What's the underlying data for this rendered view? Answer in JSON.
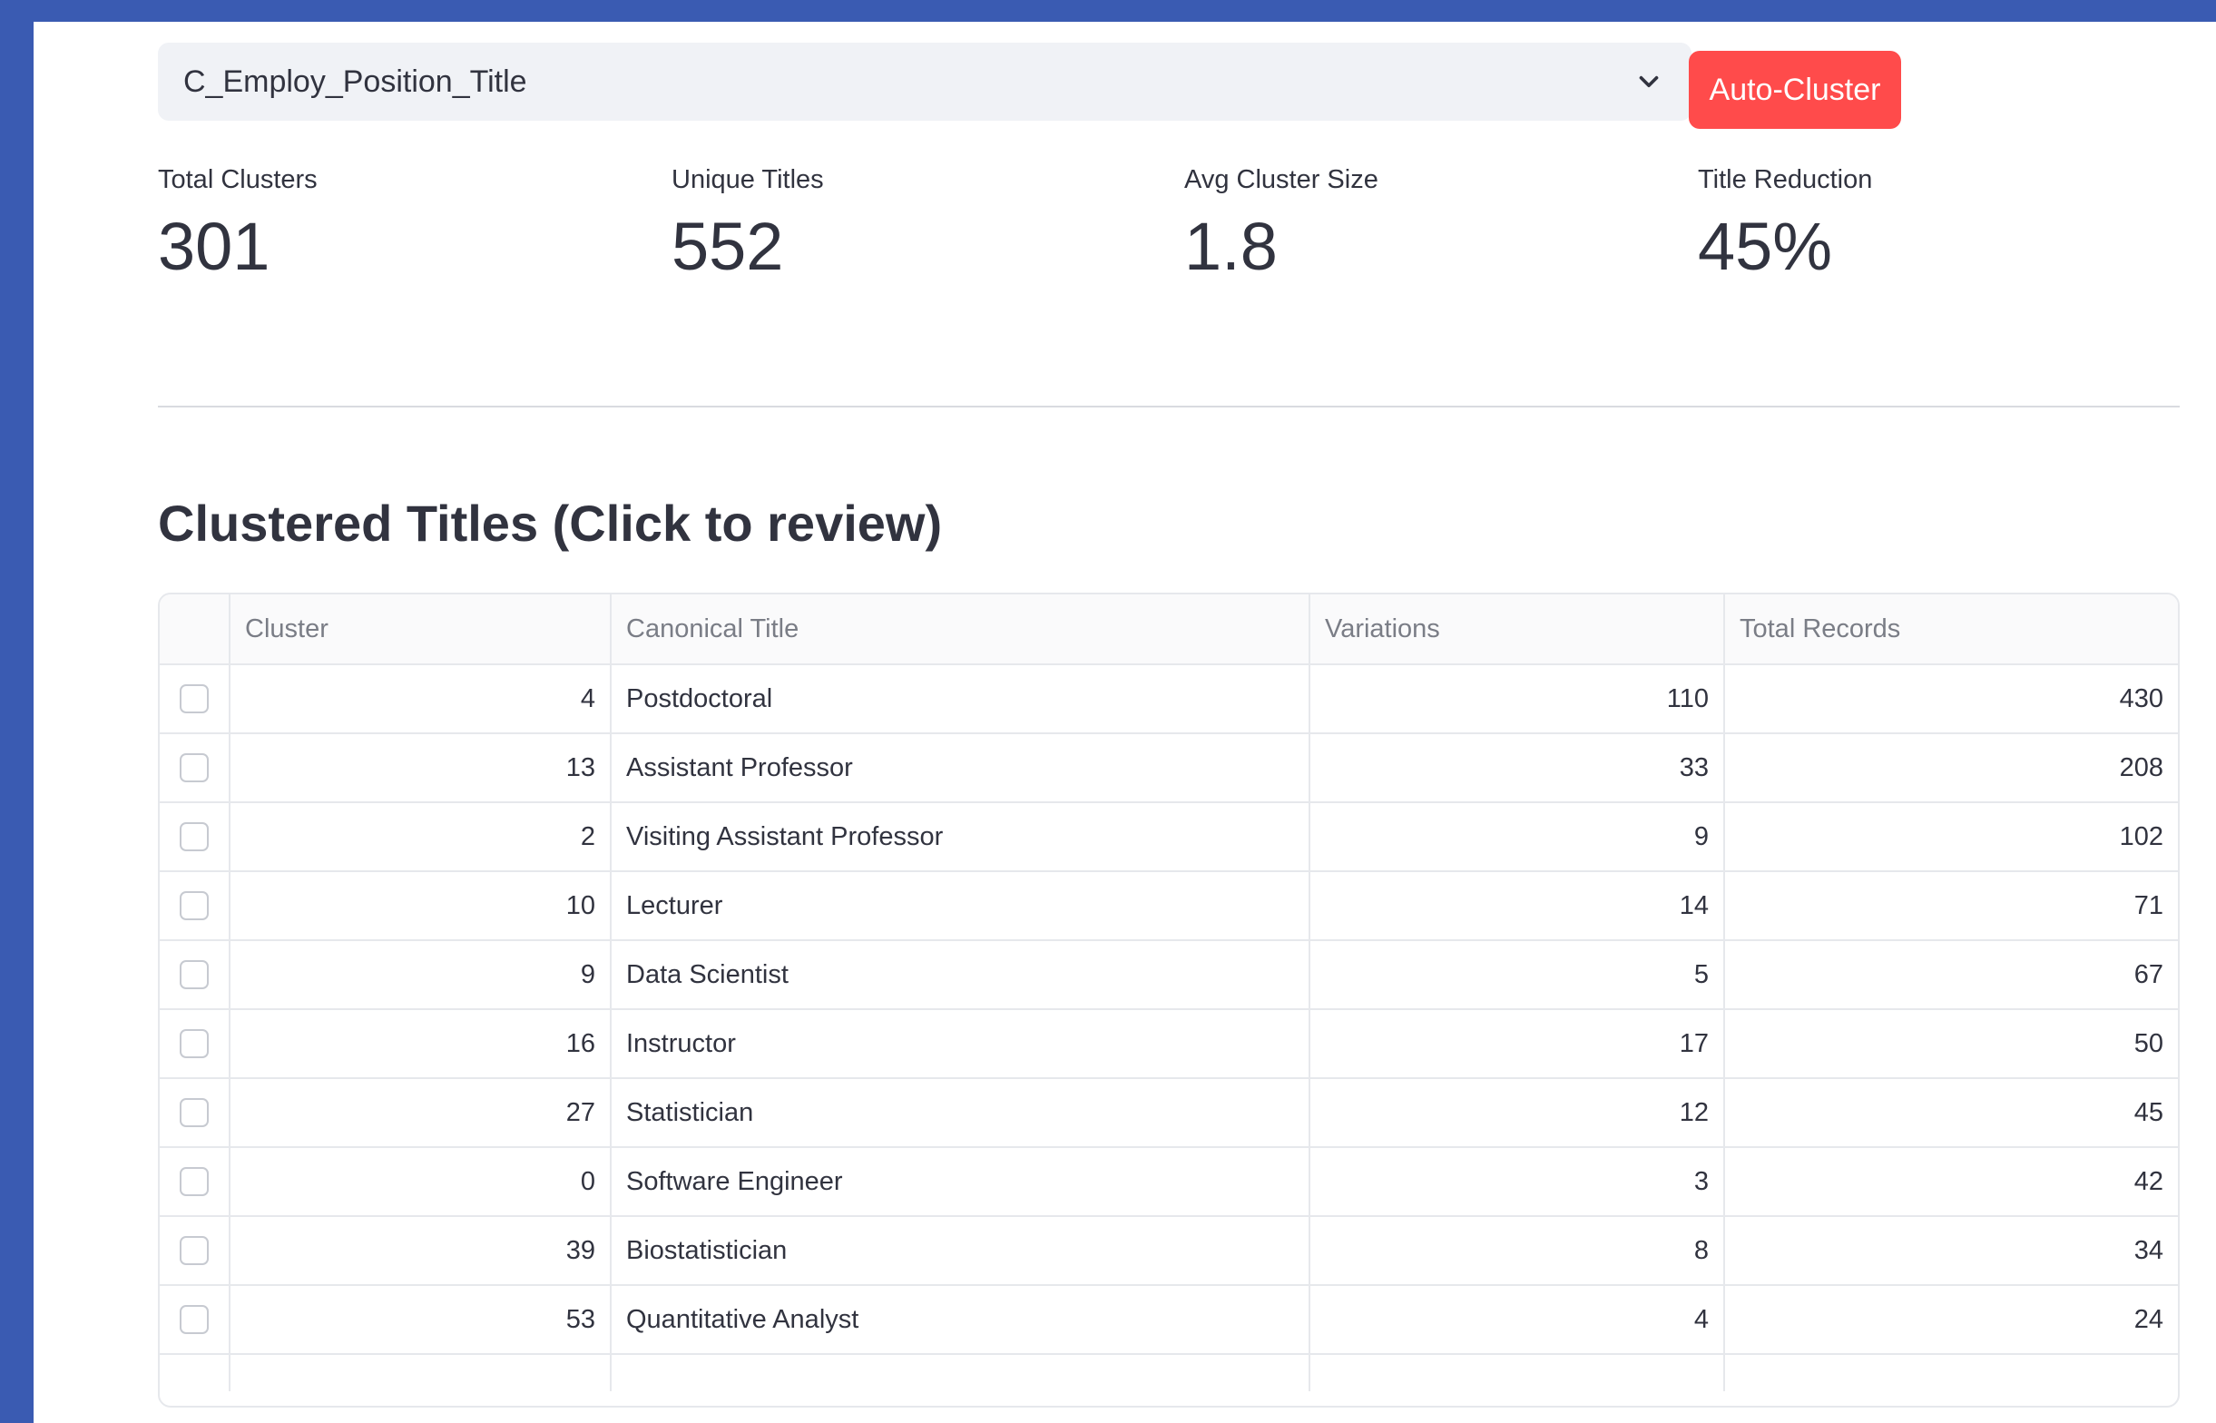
{
  "select": {
    "value": "C_Employ_Position_Title",
    "icon": "chevron-down-icon"
  },
  "button": {
    "label": "Auto-Cluster",
    "color": "#ff4b4b"
  },
  "metrics": [
    {
      "label": "Total Clusters",
      "value": "301"
    },
    {
      "label": "Unique Titles",
      "value": "552"
    },
    {
      "label": "Avg Cluster Size",
      "value": "1.8"
    },
    {
      "label": "Title Reduction",
      "value": "45%"
    }
  ],
  "section_title": "Clustered Titles (Click to review)",
  "table": {
    "headers": [
      "Cluster",
      "Canonical Title",
      "Variations",
      "Total Records"
    ],
    "rows": [
      {
        "cluster": "4",
        "title": "Postdoctoral",
        "variations": "110",
        "records": "430"
      },
      {
        "cluster": "13",
        "title": "Assistant Professor",
        "variations": "33",
        "records": "208"
      },
      {
        "cluster": "2",
        "title": "Visiting Assistant Professor",
        "variations": "9",
        "records": "102"
      },
      {
        "cluster": "10",
        "title": "Lecturer",
        "variations": "14",
        "records": "71"
      },
      {
        "cluster": "9",
        "title": "Data Scientist",
        "variations": "5",
        "records": "67"
      },
      {
        "cluster": "16",
        "title": "Instructor",
        "variations": "17",
        "records": "50"
      },
      {
        "cluster": "27",
        "title": "Statistician",
        "variations": "12",
        "records": "45"
      },
      {
        "cluster": "0",
        "title": "Software Engineer",
        "variations": "3",
        "records": "42"
      },
      {
        "cluster": "39",
        "title": "Biostatistician",
        "variations": "8",
        "records": "34"
      },
      {
        "cluster": "53",
        "title": "Quantitative Analyst",
        "variations": "4",
        "records": "24"
      }
    ]
  },
  "colors": {
    "frame": "#3a5bb2",
    "accent": "#ff4b4b"
  }
}
